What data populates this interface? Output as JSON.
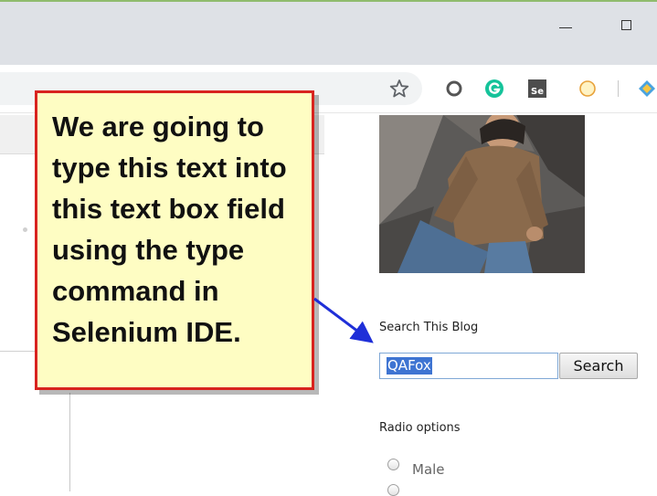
{
  "browser": {
    "window_controls": {
      "minimize": "minimize-icon",
      "maximize": "maximize-icon"
    },
    "toolbar_icons": [
      "star-icon",
      "extension-circle-icon",
      "grammarly-icon",
      "selenium-ide-icon",
      "extension-compass-icon",
      "extension-diamond-icon"
    ],
    "selenium_icon_text": "Se"
  },
  "sidebar": {
    "search": {
      "heading": "Search This Blog",
      "input_value": "QAFox",
      "button_label": "Search"
    },
    "radio": {
      "heading": "Radio options",
      "options": [
        "Male"
      ]
    }
  },
  "annotation": {
    "callout_text": "We are going to type this text into this text box field using the type command in Selenium IDE."
  },
  "colors": {
    "callout_border": "#d8231f",
    "callout_fill": "#fefdc3",
    "arrow": "#1f2fd8",
    "selection": "#3e74d2",
    "input_border": "#7fa8d6"
  }
}
